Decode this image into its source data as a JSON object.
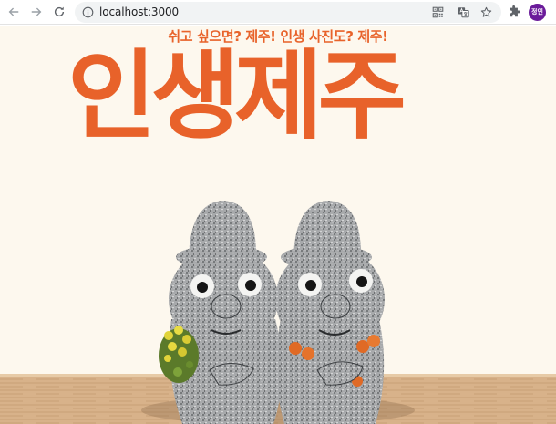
{
  "browser": {
    "url": "localhost:3000",
    "profile_initials": "정인",
    "icons": {
      "back": "arrow-left-icon",
      "forward": "arrow-right-icon",
      "reload": "reload-icon",
      "site_info": "info-icon",
      "qr": "qr-code-icon",
      "translate": "translate-icon",
      "bookmark": "star-icon",
      "extensions": "puzzle-icon"
    }
  },
  "page": {
    "tagline": "쉬고 싶으면? 제주! 인생 사진도? 제주!",
    "title": "인생제주",
    "colors": {
      "accent": "#e8622a",
      "background": "#fdf8ee"
    },
    "photo_subject": "dol-hareubang-figurines"
  }
}
